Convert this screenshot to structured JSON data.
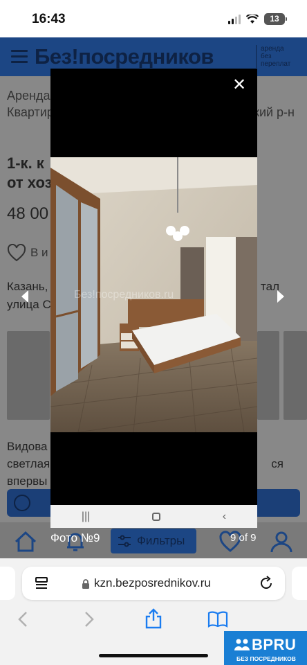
{
  "status": {
    "time": "16:43",
    "battery": "13"
  },
  "site": {
    "logo": "Без!посредников",
    "logo_sub": [
      "аренда",
      "без",
      "переплат"
    ],
    "breadcrumb_line1": "Аренда",
    "breadcrumb_line2": "Квартир",
    "breadcrumb_tail": "кий р-н",
    "title_line1": "1-к. к",
    "title_line2": "от хоз",
    "price": "48 00",
    "favorite_label": "В и",
    "address_line1": "Казань,",
    "address_tail": "тал",
    "address_line2": "улица С",
    "description_line1": "Видова",
    "description_line2": "светлая",
    "description_tail": "ся",
    "description_line3": "впервы",
    "filters_label": "Фильтры"
  },
  "viewer": {
    "watermark": "Без!посредников.ru",
    "photo_label": "Фото №9",
    "counter": "9 of 9",
    "colors": {
      "backdrop": "#000000",
      "android_bar": "#f1f1f1"
    }
  },
  "browser": {
    "url": "kzn.bezposrednikov.ru"
  },
  "badge": {
    "main": "BPRU",
    "sub": "БЕЗ ПОСРЕДНИКОВ",
    "color": "#1a7fd4"
  }
}
